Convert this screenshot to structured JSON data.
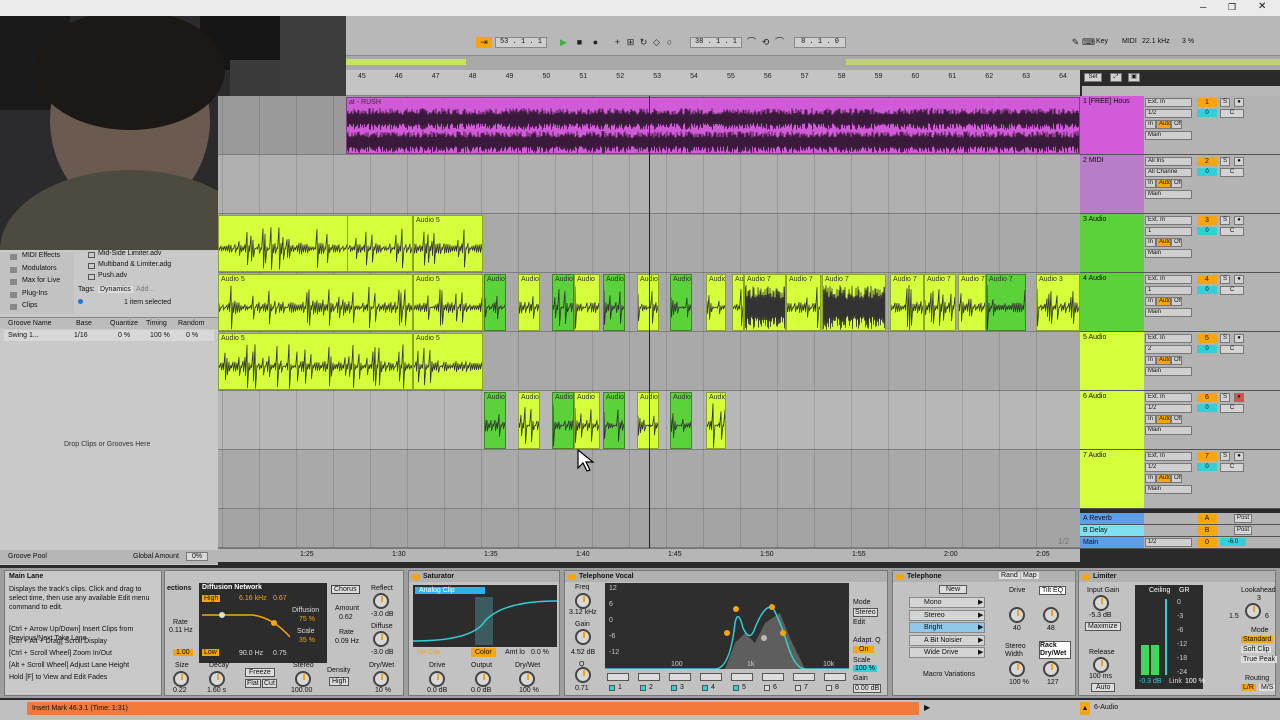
{
  "colors": {
    "magenta": "#d15ad8",
    "lime": "#d4ff3a",
    "green": "#5bd13a",
    "orange": "#f6a50c",
    "cyan": "#2fd0d8",
    "insert": "#f07a3c"
  },
  "transport": {
    "position": "53 . 1 . 1",
    "loop_start": "38 . 1 . 1",
    "loop_len": "8 . 1 . 0",
    "key": "Key",
    "midi": "MIDI",
    "sample_rate": "22.1 kHz",
    "cpu": "3 %"
  },
  "ruler": {
    "bars": [
      "45",
      "46",
      "47",
      "48",
      "49",
      "50",
      "51",
      "52",
      "53",
      "54",
      "55",
      "56",
      "57",
      "58",
      "59",
      "60",
      "61",
      "62",
      "63",
      "64"
    ],
    "set_label": "Set"
  },
  "timeline": {
    "times": [
      "1:25",
      "1:30",
      "1:35",
      "1:40",
      "1:45",
      "1:50",
      "1:55",
      "2:00",
      "2:05"
    ],
    "page": "1/2"
  },
  "tracks": [
    {
      "name": "1 [FREE] Hous",
      "input": "Ext. In",
      "ch": "1/2",
      "mon": "In",
      "auto": "Auto",
      "off": "Off",
      "out": "Main",
      "num": "1",
      "vol": "0",
      "pan": "C",
      "color": "#d15ad8",
      "clip_title": "at - RUSH"
    },
    {
      "name": "2 MIDI",
      "input": "All Ins",
      "ch": "All Channe",
      "mon": "In",
      "auto": "Auto",
      "off": "Off",
      "out": "Main",
      "num": "2",
      "vol": "0",
      "pan": "C",
      "color": "#b87cc8"
    },
    {
      "name": "3 Audio",
      "input": "Ext. In",
      "ch": "1",
      "mon": "In",
      "auto": "Auto",
      "off": "Off",
      "out": "Main",
      "num": "3",
      "vol": "0",
      "pan": "C",
      "color": "#5bd13a"
    },
    {
      "name": "4 Audio",
      "input": "Ext. In",
      "ch": "1",
      "mon": "In",
      "auto": "Auto",
      "off": "Off",
      "out": "Main",
      "num": "4",
      "vol": "0",
      "pan": "C",
      "color": "#5bd13a"
    },
    {
      "name": "5 Audio",
      "input": "Ext. In",
      "ch": "2",
      "mon": "In",
      "auto": "Auto",
      "off": "Off",
      "out": "Main",
      "num": "5",
      "vol": "0",
      "pan": "C",
      "color": "#d4ff3a"
    },
    {
      "name": "6 Audio",
      "input": "Ext. In",
      "ch": "1/2",
      "mon": "In",
      "auto": "Auto",
      "off": "Off",
      "out": "Main",
      "num": "6",
      "vol": "0",
      "pan": "C",
      "color": "#d4ff3a"
    },
    {
      "name": "7 Audio",
      "input": "Ext. In",
      "ch": "1/2",
      "mon": "In",
      "auto": "Auto",
      "off": "Off",
      "out": "Main",
      "num": "7",
      "vol": "0",
      "pan": "C",
      "color": "#d4ff3a"
    }
  ],
  "returns": [
    {
      "name": "A Reverb",
      "letter": "A",
      "post": "Post"
    },
    {
      "name": "B Delay",
      "letter": "B",
      "post": "Post"
    },
    {
      "name": "Main",
      "letter": "0",
      "ch": "1/2",
      "vol": "-6.0"
    }
  ],
  "clip_labels": {
    "audio5": "Audio 5",
    "audio": "Audio",
    "audio7": "Audio 7",
    "audio3": "Audio 3"
  },
  "browser": {
    "items": [
      "MIDI Effects",
      "Modulators",
      "Max for Live",
      "Plug-Ins",
      "Clips"
    ],
    "files": [
      "Mid-Side Limiter.adv",
      "Multiband & Limiter.adg",
      "Push.adv"
    ],
    "tags_label": "Tags:",
    "tag": "Dynamics",
    "tag_add": "Add...",
    "selected": "1 item selected",
    "groove_headers": [
      "Groove Name",
      "Base",
      "Quantize",
      "Timing",
      "Random"
    ],
    "groove_row": [
      "Swing 1...",
      "1/16",
      "0 %",
      "100 %",
      "0 %"
    ],
    "drop": "Drop Clips or Grooves Here",
    "groove_pool": "Groove Pool",
    "global_amount": "Global Amount",
    "global_val": "0%"
  },
  "info": {
    "title": "Main Lane",
    "text": "Displays the track's clips. Click and drag to select time, then use any available Edit menu command to edit.",
    "shortcuts": [
      "[Ctrl + Arrow Up/Down] Insert Clips from Previous/Next Take Lane",
      "[Ctrl + Alt + Drag] Scroll Display",
      "[Ctrl + Scroll Wheel] Zoom In/Out",
      "[Alt + Scroll Wheel] Adjust Lane Height",
      "Hold [F] to View and Edit Fades"
    ]
  },
  "reverb": {
    "sec": "ections",
    "title": "Diffusion Network",
    "chorus": "Chorus",
    "high": "High",
    "freq": "6.16 kHz",
    "q": "0.67",
    "diffusion": "Diffusion",
    "diff_val": "75 %",
    "scale": "Scale",
    "scale_val": "35 %",
    "amount": "Amount",
    "amount_val": "0.62",
    "rate": "Rate",
    "rate_val": "0.09 Hz",
    "reflect": "Reflect",
    "reflect_val": "-3.0 dB",
    "diffuse": "Diffuse",
    "diffuse_val": "-3.0 dB",
    "rate2": "Rate",
    "rate2_val": "0.11 Hz",
    "low": "Low",
    "low_freq": "90.0 Hz",
    "low_q": "0.75",
    "size": "Size",
    "size_val": "0.22",
    "decay": "Decay",
    "decay_val": "1.60 s",
    "freeze": "Freeze",
    "flat": "Flat",
    "cut": "Cut",
    "stereo": "Stereo",
    "stereo_val": "100.00",
    "density": "Density",
    "density_val": "High",
    "drywet": "Dry/Wet",
    "drywet_val": "10 %",
    "one": "1.00"
  },
  "saturator": {
    "title": "Saturator",
    "mode": "Analog Clip",
    "noclip": "No Clip",
    "color": "Color",
    "amt": "Amt lo",
    "amt_val": "0.0 %",
    "drive": "Drive",
    "drive_val": "0.0 dB",
    "output": "Output",
    "output_val": "0.0 dB",
    "drywet": "Dry/Wet",
    "drywet_val": "100 %"
  },
  "eq": {
    "title": "Telephone Vocal",
    "freq": "Freq",
    "freq_val": "3.12 kHz",
    "gain": "Gain",
    "gain_val": "4.52 dB",
    "q": "Q",
    "q_val": "0.71",
    "db": [
      "12",
      "6",
      "0",
      "-6",
      "-12"
    ],
    "hz": [
      "100",
      "1k",
      "10k"
    ],
    "mode": "Mode",
    "stereo": "Stereo",
    "edit": "Edit",
    "adapt": "Adapt. Q",
    "on": "On",
    "scale": "Scale",
    "scale_val": "100 %",
    "gain2": "Gain",
    "gain2_val": "0.00 dB",
    "bands": [
      "1",
      "2",
      "3",
      "4",
      "5",
      "6",
      "7",
      "8"
    ]
  },
  "rack": {
    "title": "Telephone",
    "rand": "Rand",
    "map": "Map",
    "new": "New",
    "chains": [
      "Mono",
      "Stereo",
      "Bright",
      "A Bit Noisier",
      "Wide Drive"
    ],
    "macro": "Macro Variations",
    "drive": "Drive",
    "drive_val": "40",
    "tilt": "Tilt EQ",
    "tilt_val": "48",
    "sw": "Stereo Width",
    "sw_val": "100 %",
    "rdw": "Rack Dry/Wet",
    "rdw_val": "127"
  },
  "limiter": {
    "title": "Limiter",
    "input": "Input Gain",
    "input_val": "-5.3 dB",
    "maximize": "Maximize",
    "ceiling": "Ceiling",
    "gr": "GR",
    "lookahead": "Lookahead",
    "lookahead_val": "3",
    "release": "Release",
    "release_val": "100 ms",
    "auto": "Auto",
    "ceiling_val": "-0.3 dB",
    "link": "Link",
    "link_val": "100 %",
    "mode": "Mode",
    "standard": "Standard",
    "soft": "Soft Clip",
    "true_peak": "True Peak",
    "routing": "Routing",
    "lr": "L/R",
    "ms": "M/S",
    "scale": [
      "0",
      "-3",
      "-6",
      "-12",
      "-18",
      "-24"
    ],
    "la_opts": [
      "1.5",
      "6"
    ]
  },
  "status": {
    "insert": "Insert Mark 46.3.1 (Time: 1:31)",
    "track": "6-Audio"
  }
}
